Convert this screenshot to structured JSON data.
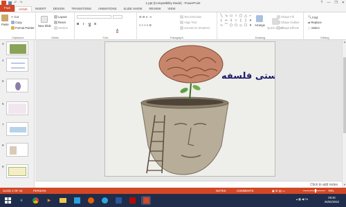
{
  "window": {
    "title": "1.ppt [Compatibility Mode] - PowerPoint",
    "controls": [
      "?",
      "—",
      "❐",
      "✕"
    ]
  },
  "tabs": [
    "FILE",
    "HOME",
    "INSERT",
    "DESIGN",
    "TRANSITIONS",
    "ANIMATIONS",
    "SLIDE SHOW",
    "REVIEW",
    "VIEW"
  ],
  "ribbon": {
    "clipboard": {
      "paste": "Paste",
      "cut": "Cut",
      "copy": "Copy",
      "format_painter": "Format Painter",
      "label": "Clipboard"
    },
    "slides": {
      "new_slide": "New Slide",
      "layout": "Layout",
      "reset": "Reset",
      "section": "Section",
      "label": "Slides"
    },
    "font": {
      "bold": "B",
      "italic": "I",
      "underline": "U",
      "strike": "S",
      "label": "Font"
    },
    "paragraph": {
      "text_direction": "Text Direction",
      "align_text": "Align Text",
      "smartart": "Convert to SmartArt",
      "label": "Paragraph"
    },
    "drawing": {
      "arrange": "Arrange",
      "quick_styles": "Quick Styles",
      "shape_fill": "Shape Fill",
      "shape_outline": "Shape Outline",
      "shape_effects": "Shape Effects",
      "label": "Drawing"
    },
    "editing": {
      "find": "Find",
      "replace": "Replace",
      "select": "Select",
      "label": "Editing"
    }
  },
  "thumbnails": [
    "3",
    "4",
    "5",
    "6",
    "7",
    "8",
    "9"
  ],
  "slide": {
    "title": "چیستی فلسفه"
  },
  "notes": {
    "placeholder": "Click to add notes"
  },
  "status": {
    "slide_indicator": "SLIDE 2 OF 22",
    "language": "PERSIAN",
    "notes": "NOTES",
    "comments": "COMMENTS",
    "zoom": "78%",
    "zoom_level": 0.55
  },
  "taskbar": {
    "time": "09:26",
    "date": "25/02/2022",
    "lang": "FA"
  },
  "colors": {
    "accent": "#D24726",
    "taskbar": "#1F2D4A"
  }
}
